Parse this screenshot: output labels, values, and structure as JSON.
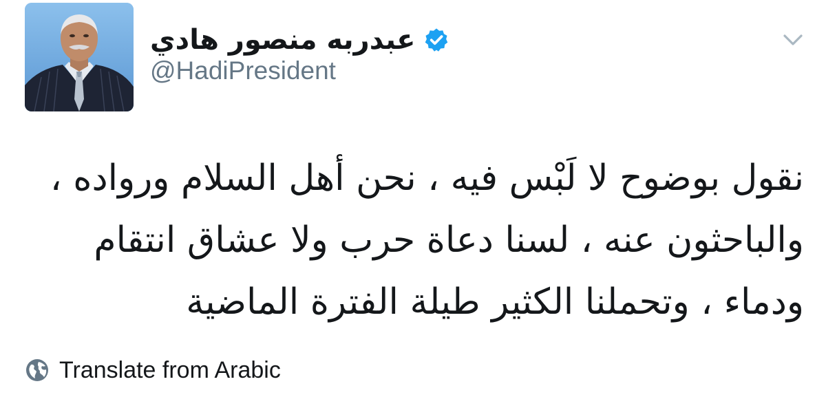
{
  "tweet": {
    "author": {
      "display_name": "عبدربه منصور هادي",
      "handle": "@HadiPresident",
      "verified": true,
      "avatar_icon": "profile-photo"
    },
    "text_lines": [
      "نقول بوضوح لا لَبْس فيه ، نحن أهل السلام ورواده ،",
      "والباحثون عنه ، لسنا  دعاة حرب ولا عشاق انتقام",
      "ودماء ، وتحملنا الكثير طيلة الفترة  الماضية"
    ],
    "menu_icon": "chevron-down-icon",
    "translate": {
      "label": "Translate from Arabic",
      "icon": "globe-icon"
    }
  },
  "colors": {
    "text": "#14171a",
    "secondary": "#657786",
    "verified_badge": "#1da1f2",
    "caret": "#aab8c2",
    "globe": "#657786"
  }
}
